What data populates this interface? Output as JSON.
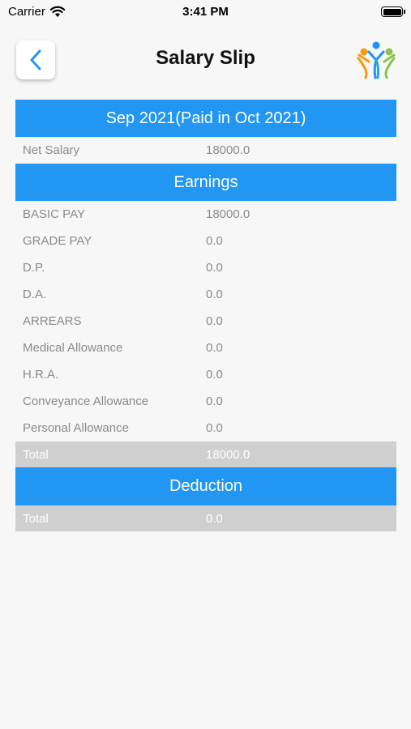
{
  "status_bar": {
    "carrier": "Carrier",
    "time": "3:41 PM"
  },
  "header": {
    "title": "Salary Slip"
  },
  "period_label": "Sep 2021(Paid in Oct 2021)",
  "net_salary": {
    "label": "Net Salary",
    "value": "18000.0"
  },
  "earnings": {
    "title": "Earnings",
    "items": [
      {
        "label": "BASIC PAY",
        "value": "18000.0"
      },
      {
        "label": "GRADE PAY",
        "value": "0.0"
      },
      {
        "label": "D.P.",
        "value": "0.0"
      },
      {
        "label": "D.A.",
        "value": "0.0"
      },
      {
        "label": "ARREARS",
        "value": "0.0"
      },
      {
        "label": "Medical Allowance",
        "value": "0.0"
      },
      {
        "label": "H.R.A.",
        "value": "0.0"
      },
      {
        "label": "Conveyance Allowance",
        "value": "0.0"
      },
      {
        "label": "Personal Allowance",
        "value": "0.0"
      }
    ],
    "total": {
      "label": "Total",
      "value": "18000.0"
    }
  },
  "deduction": {
    "title": "Deduction",
    "total": {
      "label": "Total",
      "value": "0.0"
    }
  },
  "colors": {
    "accent": "#2196f3",
    "total_bg": "#cfcfcf",
    "label_text": "#8a8a8a"
  },
  "icons": {
    "back": "chevron-left-icon",
    "logo": "people-logo-icon",
    "wifi": "wifi-icon",
    "battery": "battery-icon"
  }
}
